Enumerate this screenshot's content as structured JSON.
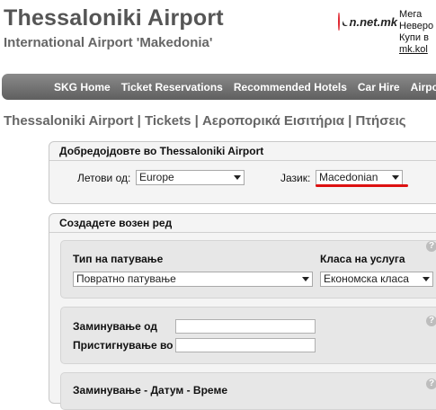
{
  "header": {
    "title": "Thessaloniki Airport",
    "subtitle": "International Airport 'Makedonia'"
  },
  "ad": {
    "logo_text": "on.net.mk",
    "lines": [
      "Мега",
      "Неверо",
      "Купи в",
      "mk.kol"
    ]
  },
  "nav": {
    "items": [
      "SKG Home",
      "Ticket Reservations",
      "Recommended Hotels",
      "Car Hire",
      "Airport"
    ]
  },
  "breadcrumb": "Thessaloniki Airport | Tickets | Αεροπορικά Εισιτήρια | Πτήσεις",
  "welcome": {
    "title": "Добредојдовте во Thessaloniki Airport",
    "flights_from_label": "Летови од:",
    "flights_from_value": "Europe",
    "language_label": "Јазик:",
    "language_value": "Macedonian"
  },
  "itinerary": {
    "title": "Создадете возен ред",
    "trip_type_label": "Тип на патување",
    "trip_type_value": "Повратно патување",
    "class_label": "Класа на услуга",
    "class_value": "Економска класа",
    "departure_label": "Заминување од",
    "arrival_label": "Пристигнување во",
    "date_time_label": "Заминување - Датум - Време",
    "help_glyph": "?"
  },
  "colors": {
    "nav_bg": "#6f6f6f",
    "title_gray": "#555555",
    "underline_red": "#dd1111",
    "panel_bg": "#f4f4f4"
  }
}
